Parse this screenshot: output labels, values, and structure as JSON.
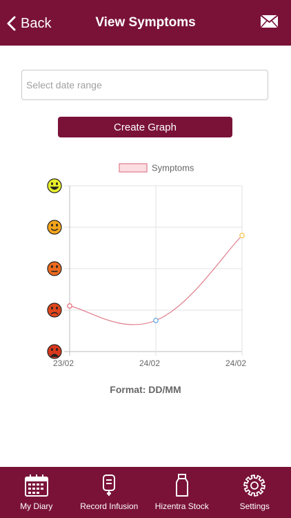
{
  "header": {
    "back_label": "Back",
    "title": "View Symptoms",
    "bg_color": "#7a1238"
  },
  "date_range": {
    "placeholder": "Select date range",
    "value": ""
  },
  "create_button": {
    "label": "Create Graph"
  },
  "chart_data": {
    "type": "line",
    "legend": {
      "label": "Symptoms",
      "placement": "top-center"
    },
    "x": [
      "23/02",
      "24/02",
      "24/02"
    ],
    "series": [
      {
        "name": "Symptoms",
        "values": [
          1.1,
          0.75,
          2.8
        ],
        "point_colors": [
          "#e8727f",
          "#6fa8e6",
          "#f5c74e"
        ]
      }
    ],
    "ylim": [
      0,
      4
    ],
    "y_icons": [
      "happy-face",
      "smiling-face",
      "neutral-face",
      "sad-face",
      "miserable-face"
    ],
    "grid": true,
    "line_color": "#e07a8a"
  },
  "format_label": "Format: DD/MM",
  "tabbar": {
    "items": [
      {
        "label": "My Diary",
        "icon": "calendar-icon"
      },
      {
        "label": "Record Infusion",
        "icon": "infusion-bag-icon"
      },
      {
        "label": "Hizentra Stock",
        "icon": "bottle-icon"
      },
      {
        "label": "Settings",
        "icon": "gear-icon"
      }
    ]
  }
}
